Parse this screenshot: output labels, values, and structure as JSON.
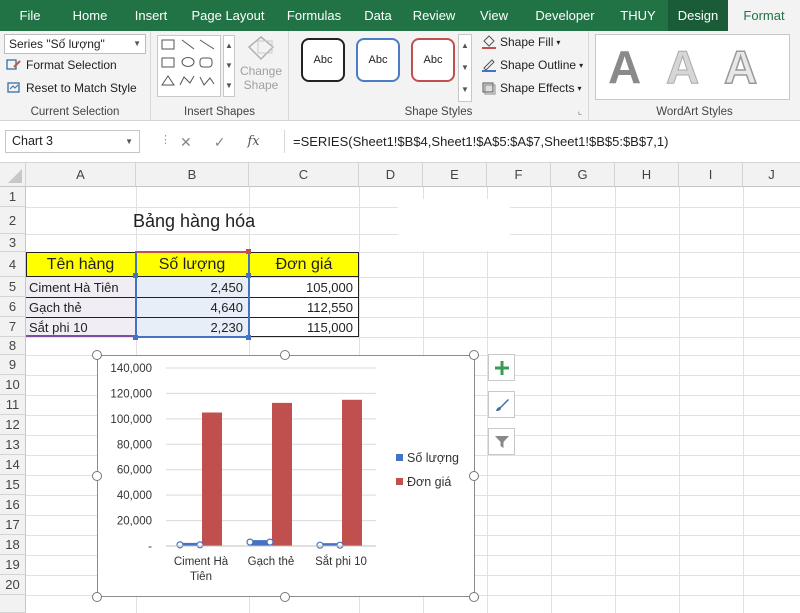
{
  "tabs": [
    "File",
    "Home",
    "Insert",
    "Page Layout",
    "Formulas",
    "Data",
    "Review",
    "View",
    "Developer",
    "THUY",
    "Design",
    "Format"
  ],
  "ribbon": {
    "current_selection": {
      "dropdown_value": "Series \"Số lượng\"",
      "format_selection": "Format Selection",
      "reset_style": "Reset to Match Style",
      "label": "Current Selection"
    },
    "insert_shapes": {
      "change_shape_line1": "Change",
      "change_shape_line2": "Shape",
      "label": "Insert Shapes"
    },
    "shape_styles": {
      "preset_text": "Abc",
      "shape_fill": "Shape Fill",
      "shape_outline": "Shape Outline",
      "shape_effects": "Shape Effects",
      "label": "Shape Styles"
    },
    "wordart": {
      "letter": "A",
      "label": "WordArt Styles"
    }
  },
  "formula_bar": {
    "name_box": "Chart 3",
    "fx": "fx",
    "formula": "=SERIES(Sheet1!$B$4,Sheet1!$A$5:$A$7,Sheet1!$B$5:$B$7,1)"
  },
  "sheet": {
    "columns": [
      "A",
      "B",
      "C",
      "D",
      "E",
      "F",
      "G",
      "H",
      "I",
      "J"
    ],
    "rows": [
      "1",
      "2",
      "3",
      "4",
      "5",
      "6",
      "7",
      "8",
      "9",
      "10",
      "11",
      "12",
      "13",
      "14",
      "15",
      "16",
      "17",
      "18",
      "19",
      "20"
    ],
    "title": "Bảng hàng hóa",
    "headers": [
      "Tên hàng",
      "Số lượng",
      "Đơn giá"
    ],
    "data_rows": [
      [
        "Ciment Hà Tiên",
        "2,450",
        "105,000"
      ],
      [
        "Gạch thẻ",
        "4,640",
        "112,550"
      ],
      [
        "Sắt phi 10",
        "2,230",
        "115,000"
      ]
    ]
  },
  "colors": {
    "excel_green": "#217346",
    "header_yellow": "#ffff00",
    "series1": "#4472c4",
    "series2": "#c0504d"
  },
  "chart_data": {
    "type": "bar",
    "categories": [
      "Ciment Hà Tiên",
      "Gạch thẻ",
      "Sắt phi 10"
    ],
    "category_lines": [
      [
        "Ciment Hà",
        "Tiên"
      ],
      [
        "Gạch thẻ"
      ],
      [
        "Sắt phi 10"
      ]
    ],
    "series": [
      {
        "name": "Số lượng",
        "values": [
          2450,
          4640,
          2230
        ],
        "color": "#4472c4"
      },
      {
        "name": "Đơn giá",
        "values": [
          105000,
          112550,
          115000
        ],
        "color": "#c0504d"
      }
    ],
    "ylim": [
      0,
      140000
    ],
    "yticks": [
      0,
      20000,
      40000,
      60000,
      80000,
      100000,
      120000,
      140000
    ],
    "ytick_labels": [
      "-",
      "20,000",
      "40,000",
      "60,000",
      "80,000",
      "100,000",
      "120,000",
      "140,000"
    ],
    "grid": true,
    "legend": "right"
  }
}
